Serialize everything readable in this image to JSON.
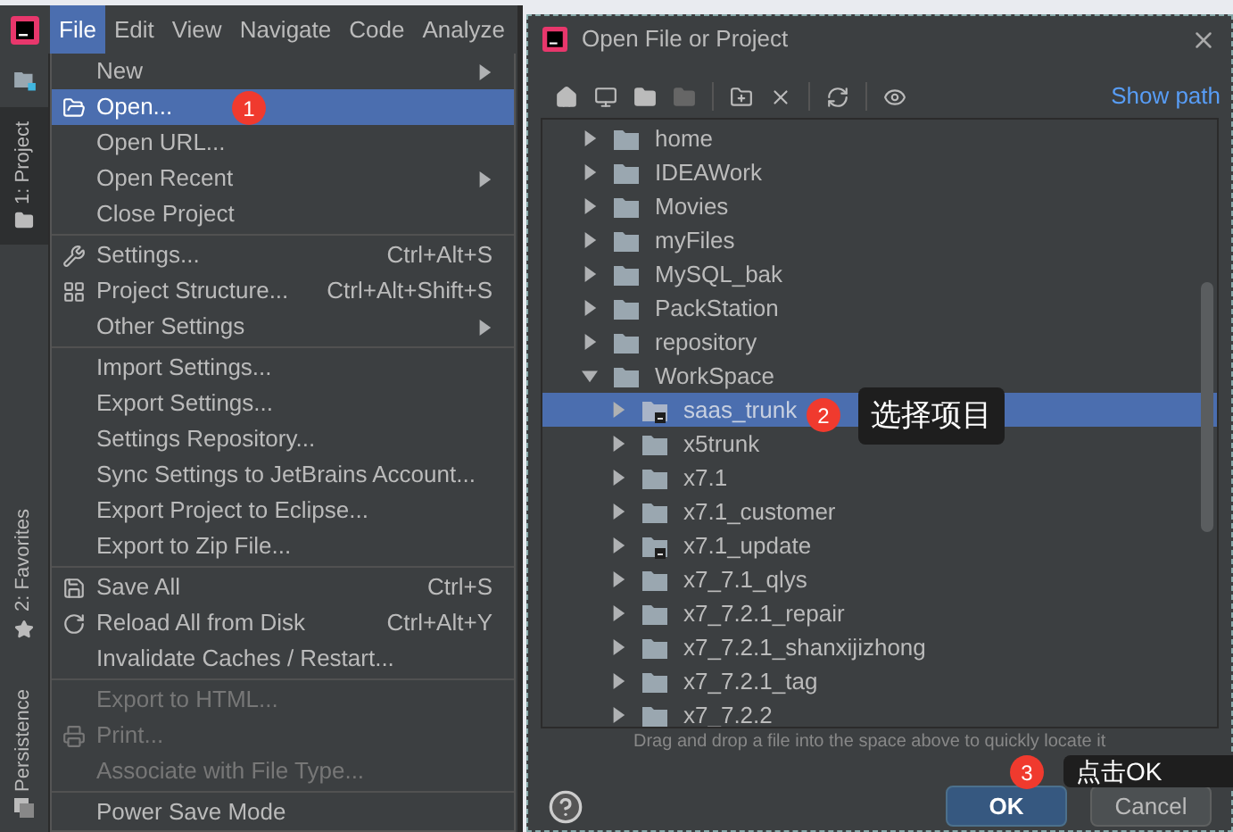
{
  "ide": {
    "menu_bar": [
      {
        "label": "File",
        "selected": true
      },
      {
        "label": "Edit",
        "selected": false
      },
      {
        "label": "View",
        "selected": false
      },
      {
        "label": "Navigate",
        "selected": false
      },
      {
        "label": "Code",
        "selected": false
      },
      {
        "label": "Analyze",
        "selected": false
      }
    ],
    "side_tabs": [
      {
        "label": "1: Project",
        "selected": true
      },
      {
        "label": "2: Favorites",
        "selected": false
      },
      {
        "label": "Persistence",
        "selected": false
      }
    ],
    "file_menu": [
      [
        {
          "label": "New",
          "submenu": true,
          "selected": false,
          "disabled": false
        },
        {
          "label": "Open...",
          "selected": true,
          "disabled": false
        },
        {
          "label": "Open URL...",
          "selected": false,
          "disabled": false
        },
        {
          "label": "Open Recent",
          "submenu": true,
          "selected": false,
          "disabled": false
        },
        {
          "label": "Close Project",
          "selected": false,
          "disabled": false
        }
      ],
      [
        {
          "label": "Settings...",
          "shortcut": "Ctrl+Alt+S",
          "selected": false,
          "disabled": false
        },
        {
          "label": "Project Structure...",
          "shortcut": "Ctrl+Alt+Shift+S",
          "selected": false,
          "disabled": false
        },
        {
          "label": "Other Settings",
          "submenu": true,
          "selected": false,
          "disabled": false
        }
      ],
      [
        {
          "label": "Import Settings...",
          "selected": false,
          "disabled": false
        },
        {
          "label": "Export Settings...",
          "selected": false,
          "disabled": false
        },
        {
          "label": "Settings Repository...",
          "selected": false,
          "disabled": false
        },
        {
          "label": "Sync Settings to JetBrains Account...",
          "selected": false,
          "disabled": false
        },
        {
          "label": "Export Project to Eclipse...",
          "selected": false,
          "disabled": false
        },
        {
          "label": "Export to Zip File...",
          "selected": false,
          "disabled": false
        }
      ],
      [
        {
          "label": "Save All",
          "shortcut": "Ctrl+S",
          "selected": false,
          "disabled": false
        },
        {
          "label": "Reload All from Disk",
          "shortcut": "Ctrl+Alt+Y",
          "selected": false,
          "disabled": false
        },
        {
          "label": "Invalidate Caches / Restart...",
          "selected": false,
          "disabled": false
        }
      ],
      [
        {
          "label": "Export to HTML...",
          "selected": false,
          "disabled": true
        },
        {
          "label": "Print...",
          "selected": false,
          "disabled": true
        },
        {
          "label": "Associate with File Type...",
          "selected": false,
          "disabled": true
        }
      ],
      [
        {
          "label": "Power Save Mode",
          "selected": false,
          "disabled": false
        }
      ]
    ]
  },
  "dialog": {
    "title": "Open File or Project",
    "show_path": "Show path",
    "tree": [
      {
        "label": "home",
        "kind": "folder",
        "expanded": false,
        "selected": false
      },
      {
        "label": "IDEAWork",
        "kind": "folder",
        "expanded": false,
        "selected": false
      },
      {
        "label": "Movies",
        "kind": "folder",
        "expanded": false,
        "selected": false
      },
      {
        "label": "myFiles",
        "kind": "folder",
        "expanded": false,
        "selected": false
      },
      {
        "label": "MySQL_bak",
        "kind": "folder",
        "expanded": false,
        "selected": false
      },
      {
        "label": "PackStation",
        "kind": "folder",
        "expanded": false,
        "selected": false
      },
      {
        "label": "repository",
        "kind": "folder",
        "expanded": false,
        "selected": false
      },
      {
        "label": "WorkSpace",
        "kind": "folder",
        "expanded": true,
        "selected": false,
        "children": [
          {
            "label": "saas_trunk",
            "kind": "module",
            "expanded": false,
            "selected": true
          },
          {
            "label": "x5trunk",
            "kind": "folder",
            "expanded": false,
            "selected": false
          },
          {
            "label": "x7.1",
            "kind": "folder",
            "expanded": false,
            "selected": false
          },
          {
            "label": "x7.1_customer",
            "kind": "folder",
            "expanded": false,
            "selected": false
          },
          {
            "label": "x7.1_update",
            "kind": "module",
            "expanded": false,
            "selected": false
          },
          {
            "label": "x7_7.1_qlys",
            "kind": "folder",
            "expanded": false,
            "selected": false
          },
          {
            "label": "x7_7.2.1_repair",
            "kind": "folder",
            "expanded": false,
            "selected": false
          },
          {
            "label": "x7_7.2.1_shanxijizhong",
            "kind": "folder",
            "expanded": false,
            "selected": false
          },
          {
            "label": "x7_7.2.1_tag",
            "kind": "folder",
            "expanded": false,
            "selected": false
          },
          {
            "label": "x7_7.2.2",
            "kind": "folder",
            "expanded": false,
            "selected": false
          }
        ]
      }
    ],
    "hint": "Drag and drop a file into the space above to quickly locate it",
    "buttons": [
      {
        "label": "OK",
        "kind": "primary"
      },
      {
        "label": "Cancel",
        "kind": "secondary"
      }
    ]
  },
  "annotations": [
    {
      "number": "1"
    },
    {
      "number": "2",
      "text": "选择项目"
    },
    {
      "number": "3",
      "text": "点击OK"
    }
  ]
}
